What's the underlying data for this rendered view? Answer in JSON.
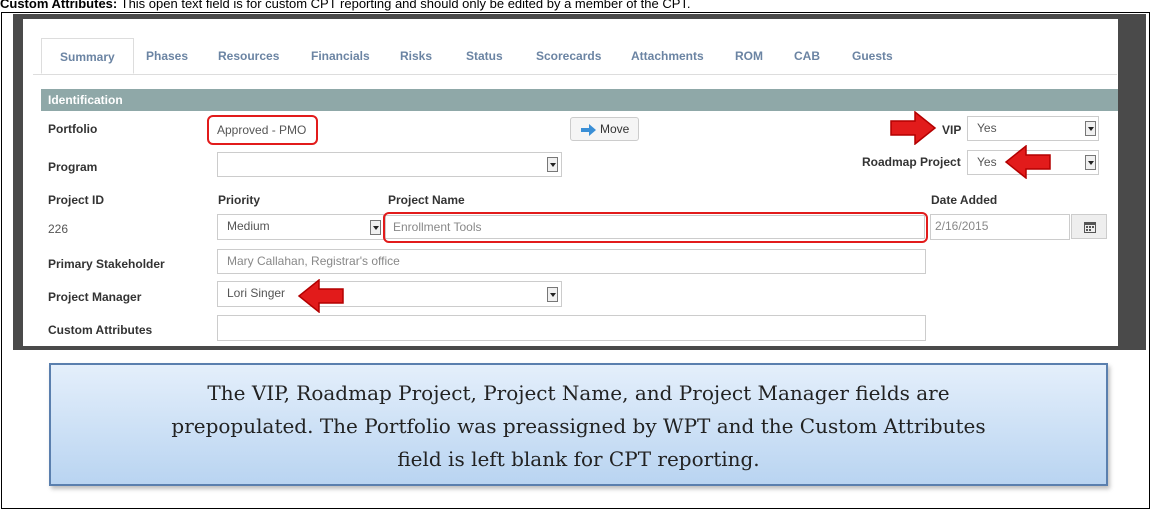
{
  "header_line": {
    "bold": "Custom Attributes:",
    "text": " This open text field is for custom CPT reporting and should only be edited by a member of the CPT."
  },
  "tabs": [
    "Summary",
    "Phases",
    "Resources",
    "Financials",
    "Risks",
    "Status",
    "Scorecards",
    "Attachments",
    "ROM",
    "CAB",
    "Guests"
  ],
  "section_title": "Identification",
  "form": {
    "portfolio_label": "Portfolio",
    "portfolio_value": "Approved - PMO",
    "move_label": "Move",
    "vip_label": "VIP",
    "vip_value": "Yes",
    "program_label": "Program",
    "program_value": "",
    "roadmap_label": "Roadmap Project",
    "roadmap_value": "Yes",
    "project_id_label": "Project ID",
    "project_id_value": "226",
    "priority_label": "Priority",
    "priority_value": "Medium",
    "project_name_label": "Project Name",
    "project_name_value": "Enrollment Tools",
    "date_added_label": "Date Added",
    "date_added_value": "2/16/2015",
    "stakeholder_label": "Primary Stakeholder",
    "stakeholder_value": "Mary Callahan, Registrar's office",
    "manager_label": "Project Manager",
    "manager_value": "Lori Singer",
    "custom_label": "Custom Attributes",
    "custom_value": ""
  },
  "callout_lines": [
    "The VIP, Roadmap Project, Project Name, and Project Manager fields are",
    "prepopulated. The Portfolio was preassigned by WPT and the Custom Attributes",
    "field is left blank for CPT reporting."
  ],
  "colors": {
    "highlight": "#e21b1b",
    "section_bar": "#8fa8a8",
    "tab_text": "#6b84a3",
    "callout_border": "#5a7fae"
  },
  "icons": [
    "arrow-right-icon",
    "calendar-icon",
    "dropdown-arrow-icon",
    "red-pointer-arrow"
  ]
}
